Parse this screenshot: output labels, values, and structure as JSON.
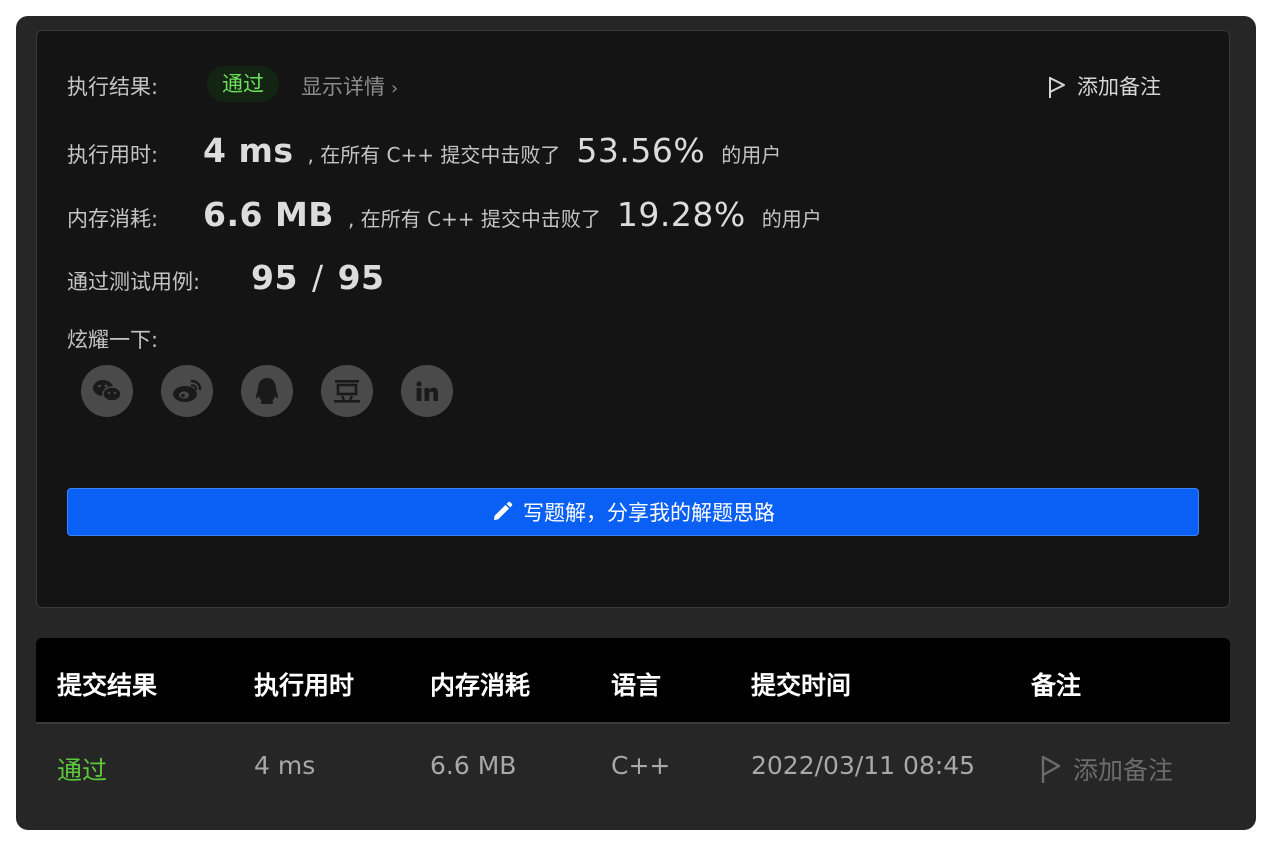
{
  "result": {
    "label": "执行结果:",
    "status": "通过",
    "details_link": "显示详情",
    "add_note": "添加备注"
  },
  "runtime": {
    "label": "执行用时:",
    "value": "4 ms",
    "mid_text": ", 在所有 C++ 提交中击败了",
    "percent": "53.56%",
    "suffix": "的用户"
  },
  "memory": {
    "label": "内存消耗:",
    "value": "6.6 MB",
    "mid_text": ", 在所有 C++ 提交中击败了",
    "percent": "19.28%",
    "suffix": "的用户"
  },
  "testcases": {
    "label": "通过测试用例:",
    "passed": "95",
    "separator": "/",
    "total": "95"
  },
  "share": {
    "label": "炫耀一下:",
    "icons": [
      "wechat-icon",
      "weibo-icon",
      "qq-icon",
      "douban-icon",
      "linkedin-icon"
    ]
  },
  "write_solution_button": "写题解，分享我的解题思路",
  "table": {
    "headers": [
      "提交结果",
      "执行用时",
      "内存消耗",
      "语言",
      "提交时间",
      "备注"
    ],
    "rows": [
      {
        "result": "通过",
        "runtime": "4 ms",
        "memory": "6.6 MB",
        "language": "C++",
        "time": "2022/03/11 08:45",
        "note": "添加备注"
      }
    ]
  },
  "colors": {
    "card_bg": "#141414",
    "window_bg": "#262626",
    "accent_blue": "#0a5ff5",
    "pass_green": "#5cc83a",
    "table_header_bg": "#000000"
  }
}
